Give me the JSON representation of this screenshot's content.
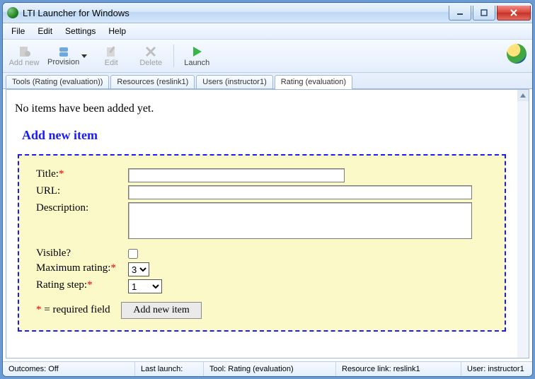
{
  "window": {
    "title": "LTI Launcher for Windows"
  },
  "menubar": {
    "file": "File",
    "edit": "Edit",
    "settings": "Settings",
    "help": "Help"
  },
  "toolbar": {
    "addnew": "Add new",
    "provision": "Provision",
    "edit": "Edit",
    "delete": "Delete",
    "launch": "Launch"
  },
  "tabs": {
    "t0": "Tools (Rating (evaluation))",
    "t1": "Resources (reslink1)",
    "t2": "Users (instructor1)",
    "t3": "Rating (evaluation)"
  },
  "content": {
    "empty_msg": "No items have been added yet.",
    "form_heading": "Add new item",
    "labels": {
      "title": "Title:",
      "url": "URL:",
      "description": "Description:",
      "visible": "Visible?",
      "max_rating": "Maximum rating:",
      "rating_step": "Rating step:"
    },
    "values": {
      "title": "",
      "url": "",
      "description": "",
      "visible": false,
      "max_rating": "3",
      "rating_step": "1"
    },
    "required_note": "* = required field",
    "submit_label": "Add new item"
  },
  "status": {
    "outcomes": "Outcomes: Off",
    "last_launch": "Last launch:",
    "tool": "Tool: Rating (evaluation)",
    "resource": "Resource link: reslink1",
    "user": "User: instructor1"
  }
}
